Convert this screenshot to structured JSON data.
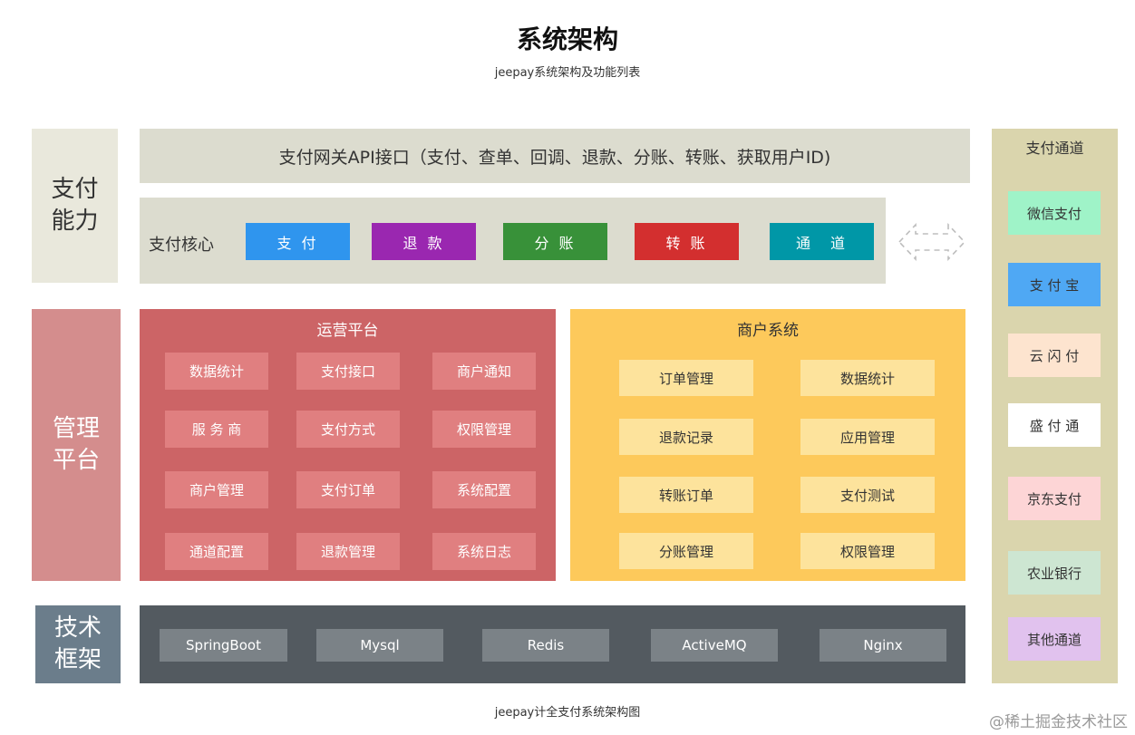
{
  "header": {
    "title": "系统架构",
    "subtitle": "jeepay系统架构及功能列表"
  },
  "left_labels": {
    "pay": [
      "支付",
      "能力"
    ],
    "mgmt": [
      "管理",
      "平台"
    ],
    "tech": [
      "技术",
      "框架"
    ]
  },
  "api_gateway": "支付网关API接口（支付、查单、回调、退款、分账、转账、获取用户ID)",
  "pay_core": {
    "label": "支付核心",
    "items": [
      {
        "label": "支 付",
        "color": "#2f95ee"
      },
      {
        "label": "退 款",
        "color": "#9a27b0"
      },
      {
        "label": "分 账",
        "color": "#389139"
      },
      {
        "label": "转 账",
        "color": "#d32f2f"
      },
      {
        "label": "通　道",
        "color": "#0097a7"
      }
    ]
  },
  "ops_platform": {
    "title": "运营平台",
    "items": [
      "数据统计",
      "支付接口",
      "商户通知",
      "服 务 商",
      "支付方式",
      "权限管理",
      "商户管理",
      "支付订单",
      "系统配置",
      "通道配置",
      "退款管理",
      "系统日志"
    ]
  },
  "merchant_system": {
    "title": "商户系统",
    "items": [
      "订单管理",
      "数据统计",
      "退款记录",
      "应用管理",
      "转账订单",
      "支付测试",
      "分账管理",
      "权限管理"
    ]
  },
  "tech_stack": [
    "SpringBoot",
    "Mysql",
    "Redis",
    "ActiveMQ",
    "Nginx"
  ],
  "channels": {
    "title": "支付通道",
    "items": [
      {
        "label": "微信支付",
        "color": "#9ff3c8"
      },
      {
        "label": "支 付 宝",
        "color": "#4fa8f4"
      },
      {
        "label": "云 闪 付",
        "color": "#fde4cf"
      },
      {
        "label": "盛 付 通",
        "color": "#ffffff"
      },
      {
        "label": "京东支付",
        "color": "#fdd5d6"
      },
      {
        "label": "农业银行",
        "color": "#cde6d2"
      },
      {
        "label": "其他通道",
        "color": "#e1c2ee"
      }
    ]
  },
  "caption": "jeepay计全支付系统架构图",
  "watermark": "@稀土掘金技术社区"
}
